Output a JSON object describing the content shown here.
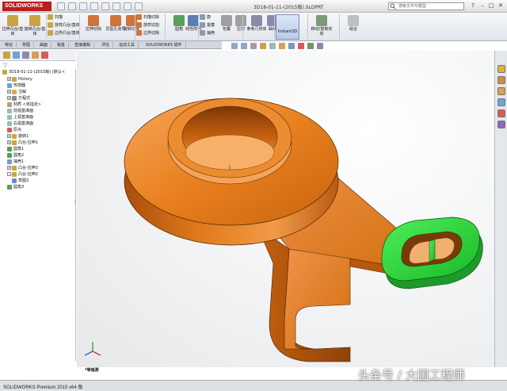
{
  "app": {
    "logo_text": "SOLIDWORKS",
    "doc_title": "3D18-01-11-(2015版).SLDPRT",
    "search_placeholder": "搜索文件与模型",
    "status": "SOLIDWORKS Premium 2015 x64 版",
    "view_label": "*等轴测",
    "watermark": "头条号 / 大国工程师"
  },
  "ribbon": {
    "big": [
      {
        "name": "extrude-boss",
        "label": "拉伸凸台/基体",
        "color": "#c9a446"
      },
      {
        "name": "revolve-boss",
        "label": "旋转凸台/基体",
        "color": "#c9a446"
      },
      {
        "name": "extrude-cut",
        "label": "拉伸切除",
        "color": "#d2733a"
      },
      {
        "name": "hole-wizard",
        "label": "异型孔向导",
        "color": "#d2733a"
      },
      {
        "name": "revolve-cut",
        "label": "旋转切除",
        "color": "#d2733a"
      },
      {
        "name": "fillet",
        "label": "圆角",
        "color": "#5aa05a"
      },
      {
        "name": "linear-pattern",
        "label": "线性阵列",
        "color": "#5a7fb5"
      },
      {
        "name": "reference-geometry",
        "label": "参考几何体",
        "color": "#8a8aa8"
      },
      {
        "name": "curves",
        "label": "曲线",
        "color": "#8a8aa8"
      },
      {
        "name": "wrap",
        "label": "包覆",
        "color": "#a0a0a0"
      },
      {
        "name": "dome",
        "label": "压凹",
        "color": "#a0a0a0"
      },
      {
        "name": "move-copy",
        "label": "移动/复制实体",
        "color": "#7a9a7a"
      },
      {
        "name": "combine",
        "label": "组合",
        "color": "#c0c0c0"
      }
    ],
    "small": [
      {
        "name": "sweep",
        "label": "扫描"
      },
      {
        "name": "loft",
        "label": "放样凸台/基体"
      },
      {
        "name": "boundary-boss",
        "label": "边界凸台/基体"
      },
      {
        "name": "sweep-cut",
        "label": "扫描切除"
      },
      {
        "name": "loft-cut",
        "label": "放样切割"
      },
      {
        "name": "boundary-cut",
        "label": "边界切除"
      },
      {
        "name": "rib",
        "label": "筋"
      },
      {
        "name": "draft",
        "label": "拔模"
      },
      {
        "name": "shell",
        "label": "抽壳"
      },
      {
        "name": "intersect",
        "label": "包覆"
      },
      {
        "name": "mirror",
        "label": "镜向"
      }
    ],
    "instant3d": "Instant3D"
  },
  "tabs": [
    {
      "name": "features",
      "label": "特征",
      "active": false
    },
    {
      "name": "sketch",
      "label": "草图",
      "active": false
    },
    {
      "name": "surfaces",
      "label": "曲面",
      "active": false
    },
    {
      "name": "sheet-metal",
      "label": "钣金",
      "active": false
    },
    {
      "name": "direct-editing",
      "label": "直接编辑",
      "active": false
    },
    {
      "name": "evaluate",
      "label": "评估",
      "active": false
    },
    {
      "name": "motion-tools",
      "label": "运动工具",
      "active": false
    },
    {
      "name": "addins",
      "label": "SOLIDWORKS 插件",
      "active": false
    }
  ],
  "tree": {
    "filter": "▽",
    "root": "3D18-01-11-(2015版) (默认<",
    "nodes": [
      {
        "label": "History",
        "icon": "#caa24a",
        "exp": "+",
        "indent": 1
      },
      {
        "label": "传感器",
        "icon": "#6aa5d8",
        "exp": "",
        "indent": 1
      },
      {
        "label": "注解",
        "icon": "#d8b04a",
        "exp": "+",
        "indent": 1
      },
      {
        "label": "方程式",
        "icon": "#8a8a8a",
        "exp": "+",
        "indent": 1
      },
      {
        "label": "材质 <未指定>",
        "icon": "#b8a070",
        "exp": "",
        "indent": 1
      },
      {
        "label": "前视基准面",
        "icon": "#9bb",
        "exp": "",
        "indent": 1
      },
      {
        "label": "上视基准面",
        "icon": "#9bb",
        "exp": "",
        "indent": 1
      },
      {
        "label": "右视基准面",
        "icon": "#9bb",
        "exp": "",
        "indent": 1
      },
      {
        "label": "原点",
        "icon": "#d85a5a",
        "exp": "",
        "indent": 1
      },
      {
        "label": "旋转1",
        "icon": "#c9a446",
        "exp": "+",
        "indent": 1
      },
      {
        "label": "凸台-拉伸1",
        "icon": "#c9a446",
        "exp": "+",
        "indent": 1
      },
      {
        "label": "圆角1",
        "icon": "#5aa05a",
        "exp": "",
        "indent": 1
      },
      {
        "label": "圆角2",
        "icon": "#5aa05a",
        "exp": "",
        "indent": 1
      },
      {
        "label": "抽壳1",
        "icon": "#7a9abf",
        "exp": "",
        "indent": 1
      },
      {
        "label": "凸台-拉伸3",
        "icon": "#c9a446",
        "exp": "+",
        "indent": 1
      },
      {
        "label": "凸台-拉伸2",
        "icon": "#c9a446",
        "exp": "-",
        "indent": 1
      },
      {
        "label": "草图3",
        "icon": "#6a8ad0",
        "exp": "",
        "indent": 2
      },
      {
        "label": "圆角3",
        "icon": "#5aa05a",
        "exp": "",
        "indent": 1
      }
    ]
  },
  "colors": {
    "model_orange": "#e0771c",
    "model_dark": "#9c4a0c",
    "selected_green": "#2bd33a",
    "logo_red": "#b91e1e"
  }
}
